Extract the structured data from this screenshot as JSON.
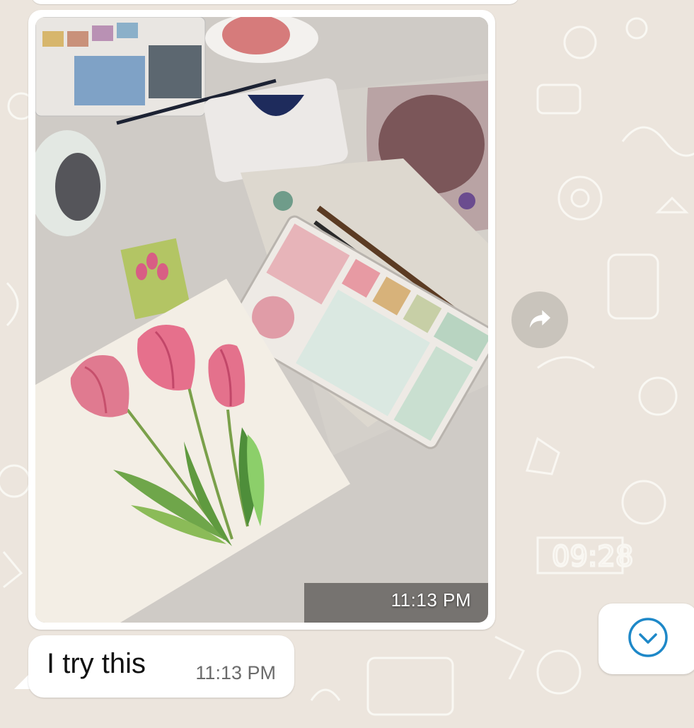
{
  "conversation": {
    "image_message": {
      "time": "11:13 PM",
      "image_alt": "Watercolor painting of three pink tulips on a table with paint palettes and brushes"
    },
    "text_message": {
      "text": "I try this",
      "time": "11:13 PM"
    }
  },
  "controls": {
    "forward_icon": "forward-arrow-icon",
    "scroll_icon": "chevron-down-circle-icon"
  },
  "colors": {
    "wallpaper": "#ece5dd",
    "bubble": "#ffffff",
    "accent": "#1e88c8"
  }
}
